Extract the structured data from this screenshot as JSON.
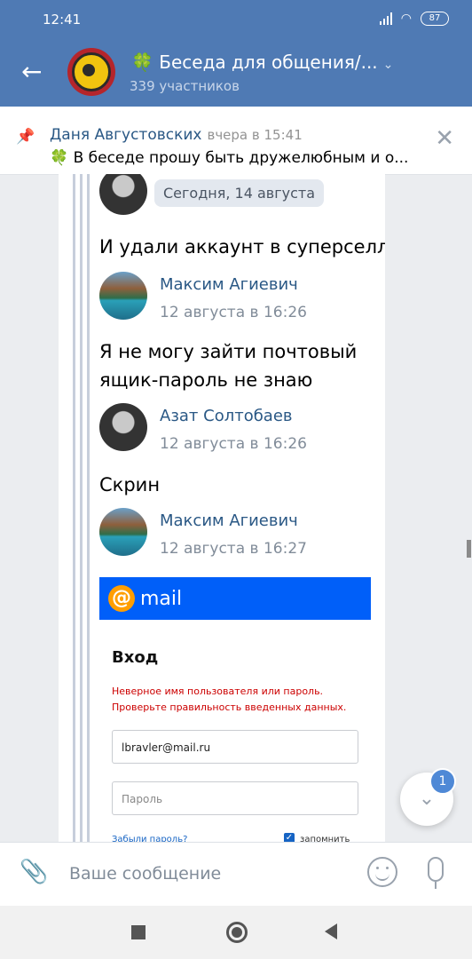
{
  "status": {
    "time": "12:41",
    "battery": "87"
  },
  "header": {
    "title": "🍀 Беседа для общения/...",
    "subtitle": "339 участников"
  },
  "pinned": {
    "author": "Даня Августовских",
    "time": "вчера в 15:41",
    "text": "🍀 В беседе прошу быть дружелюбным и о..."
  },
  "screenshot": {
    "date_separator": "Сегодня, 14 августа",
    "messages": [
      {
        "text": "И удали аккаунт в суперселл"
      },
      {
        "author": "Максим Агиевич",
        "time": "12 августа в 16:26"
      },
      {
        "text_line1": "Я не могу зайти почтовый",
        "text_line2": "ящик-пароль не знаю"
      },
      {
        "author": "Азат Солтобаев",
        "time": "12 августа в 16:26"
      },
      {
        "text": "Скрин"
      },
      {
        "author": "Максим Агиевич",
        "time": "12 августа в 16:27"
      }
    ],
    "mail": {
      "brand": "mail",
      "login_title": "Вход",
      "error_line1": "Неверное имя пользователя или пароль.",
      "error_line2": "Проверьте правильность введенных данных.",
      "email_value": "lbravler@mail.ru",
      "password_placeholder": "Пароль",
      "forgot": "Забыли пароль?",
      "remember": "запомнить"
    }
  },
  "fab": {
    "badge": "1"
  },
  "composer": {
    "placeholder": "Ваше сообщение"
  }
}
